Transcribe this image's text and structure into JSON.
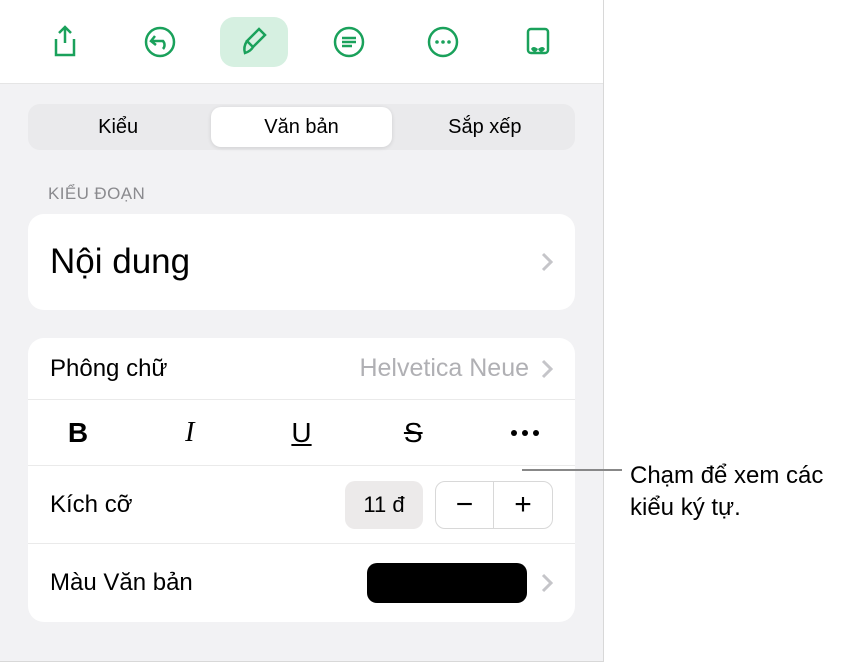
{
  "toolbar": {
    "share_icon": "share",
    "undo_icon": "undo",
    "brush_icon": "brush",
    "comment_icon": "comment",
    "more_icon": "more",
    "read_icon": "read"
  },
  "tabs": {
    "style": "Kiểu",
    "text": "Văn bản",
    "arrange": "Sắp xếp"
  },
  "section": {
    "paragraph_styles": "KIỂU ĐOẠN"
  },
  "paragraph": {
    "style_name": "Nội dung"
  },
  "font": {
    "label": "Phông chữ",
    "value": "Helvetica Neue"
  },
  "style_buttons": {
    "bold": "B",
    "italic": "I",
    "underline": "U",
    "strike": "S"
  },
  "size": {
    "label": "Kích cỡ",
    "value": "11 đ",
    "minus": "−",
    "plus": "+"
  },
  "text_color": {
    "label": "Màu Văn bản",
    "value": "#000000"
  },
  "callout": {
    "text": "Chạm để xem các kiểu ký tự."
  }
}
